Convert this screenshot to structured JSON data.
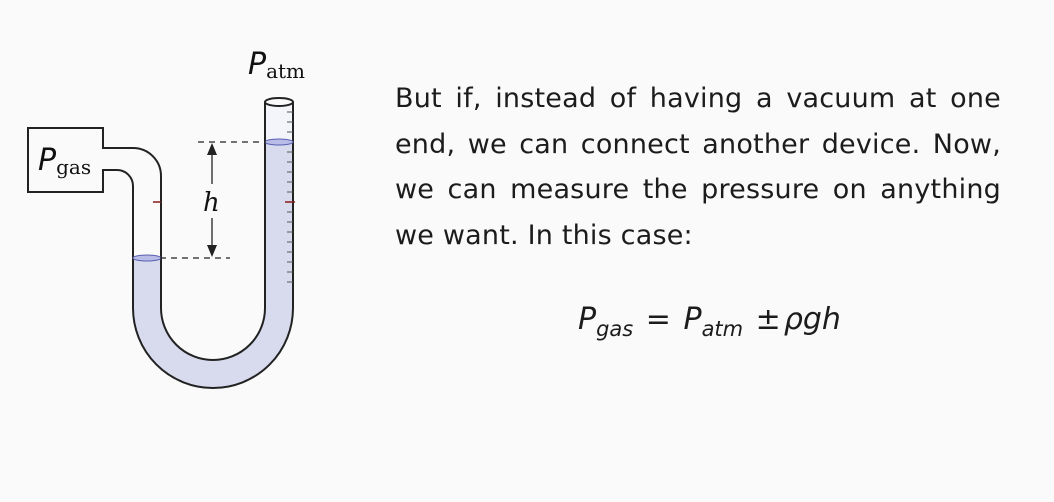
{
  "diagram": {
    "labels": {
      "p_atm_main": "P",
      "p_atm_sub": "atm",
      "p_gas_main": "P",
      "p_gas_sub": "gas",
      "height": "h"
    },
    "colors": {
      "liquid": "#d8dbee",
      "liquid_surface": "#b8bce6",
      "tube_outline": "#222222",
      "tick_accent": "#8b1a1a"
    }
  },
  "text": {
    "paragraph": "But if, instead of having a vacuum at one end, we can connect another device.  Now, we can measure the pressure on anything we want. In this case:"
  },
  "equation": {
    "lhs_var": "P",
    "lhs_sub": "gas",
    "eq": "=",
    "rhs_var": "P",
    "rhs_sub": "atm",
    "op": "±",
    "tail": "ρgh"
  }
}
